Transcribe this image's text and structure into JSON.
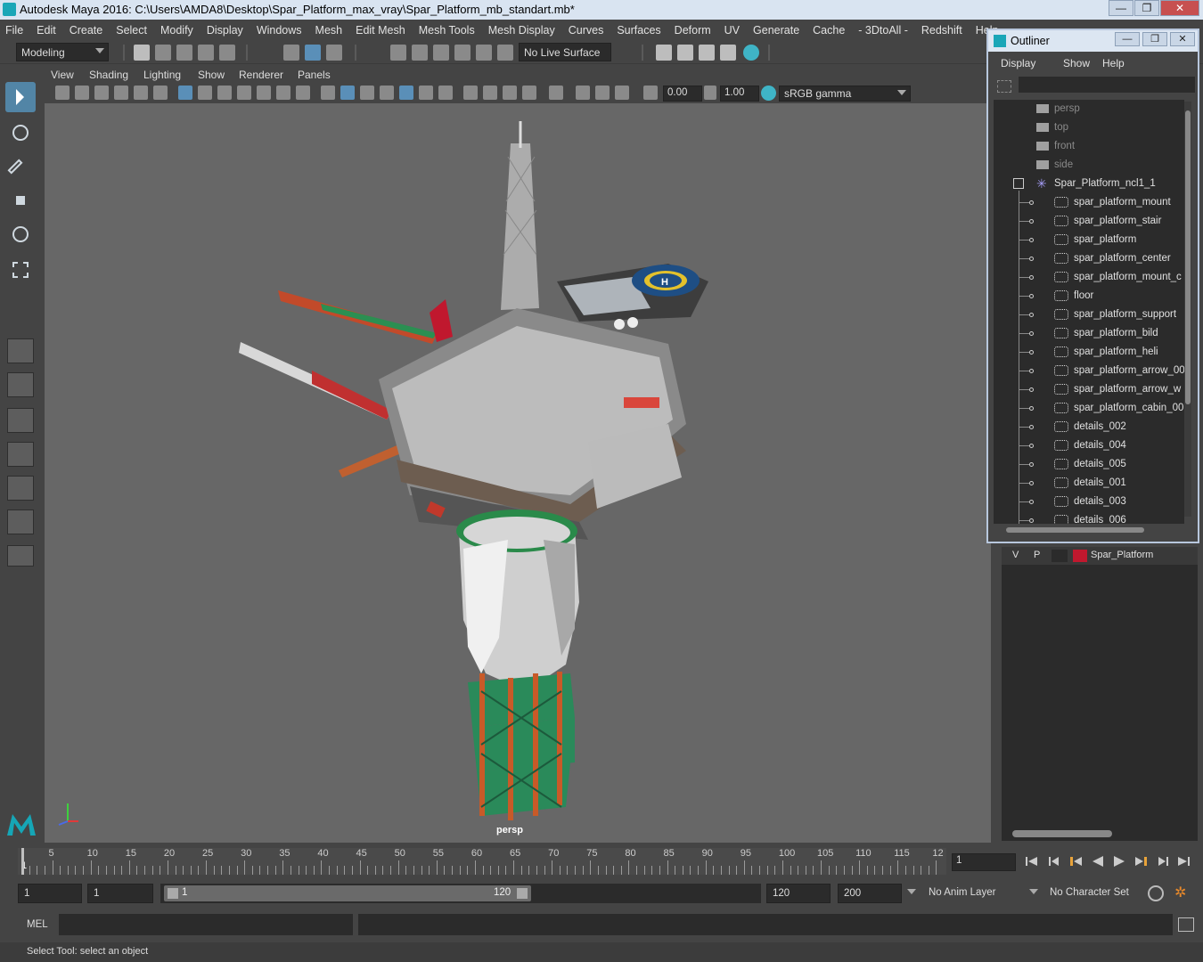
{
  "window": {
    "title": "Autodesk Maya 2016: C:\\Users\\AMDA8\\Desktop\\Spar_Platform_max_vray\\Spar_Platform_mb_standart.mb*",
    "min_glyph": "—",
    "max_glyph": "❐",
    "close_glyph": "✕"
  },
  "menubar": [
    "File",
    "Edit",
    "Create",
    "Select",
    "Modify",
    "Display",
    "Windows",
    "Mesh",
    "Edit Mesh",
    "Mesh Tools",
    "Mesh Display",
    "Curves",
    "Surfaces",
    "Deform",
    "UV",
    "Generate",
    "Cache",
    "- 3DtoAll -",
    "Redshift",
    "Help"
  ],
  "statusline": {
    "mode": "Modeling",
    "live_surface": "No Live Surface"
  },
  "panel": {
    "menu": [
      "View",
      "Shading",
      "Lighting",
      "Show",
      "Renderer",
      "Panels"
    ],
    "exposure": "0.00",
    "gamma": "1.00",
    "colorspace": "sRGB gamma",
    "camera": "persp"
  },
  "outliner": {
    "title": "Outliner",
    "menu": [
      "Display",
      "Show",
      "Help"
    ],
    "cameras": [
      "persp",
      "top",
      "front",
      "side"
    ],
    "group": "Spar_Platform_ncl1_1",
    "children": [
      "spar_platform_mount",
      "spar_platform_stair",
      "spar_platform",
      "spar_platform_center",
      "spar_platform_mount_c",
      "floor",
      "spar_platform_support",
      "spar_platform_bild",
      "spar_platform_heli",
      "spar_platform_arrow_00",
      "spar_platform_arrow_w",
      "spar_platform_cabin_00",
      "details_002",
      "details_004",
      "details_005",
      "details_001",
      "details_003",
      "details_006"
    ]
  },
  "layer": {
    "v": "V",
    "p": "P",
    "name": "Spar_Platform",
    "color": "#c0182e"
  },
  "timeline": {
    "ticks": [
      "5",
      "10",
      "15",
      "20",
      "25",
      "30",
      "35",
      "40",
      "45",
      "50",
      "55",
      "60",
      "65",
      "70",
      "75",
      "80",
      "85",
      "90",
      "95",
      "100",
      "105",
      "110",
      "115",
      "12"
    ],
    "start_label": "1",
    "current_frame": "1"
  },
  "range": {
    "start": "1",
    "playback_start": "1",
    "slider_start": "1",
    "slider_end": "120",
    "playback_end": "120",
    "end": "200",
    "anim_layer": "No Anim Layer",
    "char_set": "No Character Set"
  },
  "cmd": {
    "label": "MEL"
  },
  "help": {
    "text": "Select Tool: select an object"
  },
  "colors": {
    "accent": "#5285a6",
    "viewport_bg": "#676767",
    "panel_bg": "#444444",
    "field_bg": "#2b2b2b"
  }
}
